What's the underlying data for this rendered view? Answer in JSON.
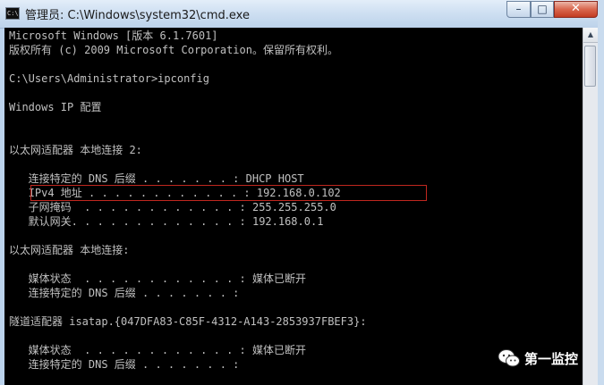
{
  "window": {
    "title": "管理员: C:\\Windows\\system32\\cmd.exe",
    "icon": "cmd-icon",
    "icon_text": "C:\\"
  },
  "titlebar_buttons": {
    "minimize": "–",
    "maximize": "□",
    "close": "✕"
  },
  "console": {
    "lines": [
      "Microsoft Windows [版本 6.1.7601]",
      "版权所有 (c) 2009 Microsoft Corporation。保留所有权利。",
      "",
      "C:\\Users\\Administrator>ipconfig",
      "",
      "Windows IP 配置",
      "",
      "",
      "以太网适配器 本地连接 2:",
      "",
      "   连接特定的 DNS 后缀 . . . . . . . : DHCP HOST",
      "   IPv4 地址 . . . . . . . . . . . . : 192.168.0.102",
      "   子网掩码  . . . . . . . . . . . . : 255.255.255.0",
      "   默认网关. . . . . . . . . . . . . : 192.168.0.1",
      "",
      "以太网适配器 本地连接:",
      "",
      "   媒体状态  . . . . . . . . . . . . : 媒体已断开",
      "   连接特定的 DNS 后缀 . . . . . . . :",
      "",
      "隧道适配器 isatap.{047DFA83-C85F-4312-A143-2853937FBEF3}:",
      "",
      "   媒体状态  . . . . . . . . . . . . : 媒体已断开",
      "   连接特定的 DNS 后缀 . . . . . . . :"
    ]
  },
  "scrollbar": {
    "up_arrow": "▲"
  },
  "watermark": {
    "text": "第一监控",
    "icon": "wechat-icon"
  },
  "colors": {
    "console_bg": "#000000",
    "console_text": "#c0c0c0",
    "highlight_border": "#c0271f"
  }
}
